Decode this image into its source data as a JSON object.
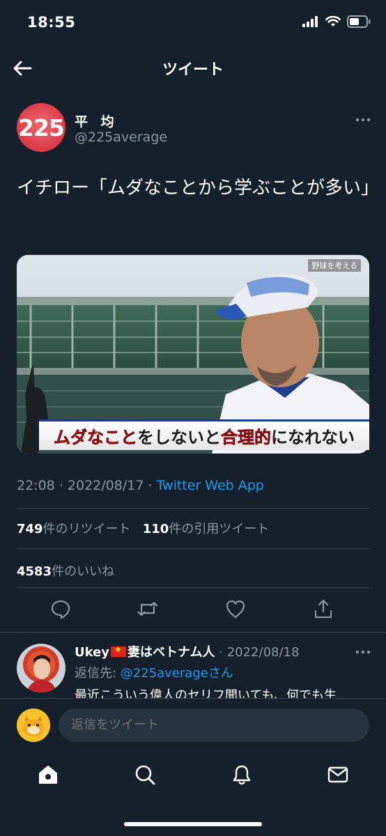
{
  "status_bar": {
    "time": "18:55"
  },
  "header": {
    "title": "ツイート"
  },
  "tweet": {
    "author_avatar_text": "225",
    "author_name": "平 均",
    "author_handle": "@225average",
    "text": "イチロー「ムダなことから学ぶことが多い」",
    "media": {
      "watermark": "野球を考える",
      "caption_parts": [
        {
          "text": "ムダなこと",
          "color": "red"
        },
        {
          "text": "をしないと",
          "color": "black"
        },
        {
          "text": "合理的",
          "color": "red"
        },
        {
          "text": "になれない",
          "color": "black"
        }
      ]
    },
    "time": "22:08",
    "separator": "·",
    "date": "2022/08/17",
    "source": "Twitter Web App",
    "retweets_count": "749",
    "retweets_label": "件のリツイート",
    "quotes_count": "110",
    "quotes_label": "件の引用ツイート",
    "likes_count": "4583",
    "likes_label": "件のいいね"
  },
  "reply": {
    "name_prefix": "Ukey",
    "name_suffix": "妻はベトナム人",
    "date": "· 2022/08/18",
    "reply_to_label": "返信先: ",
    "reply_to_handle": "@225averageさん",
    "text": "最近こういう偉人のセリフ聞いても、何でも生"
  },
  "composer": {
    "placeholder": "返信をツイート"
  },
  "colors": {
    "background": "#15202b",
    "accent": "#1d9bf0",
    "muted": "#8b98a5",
    "divider": "#38444d"
  }
}
